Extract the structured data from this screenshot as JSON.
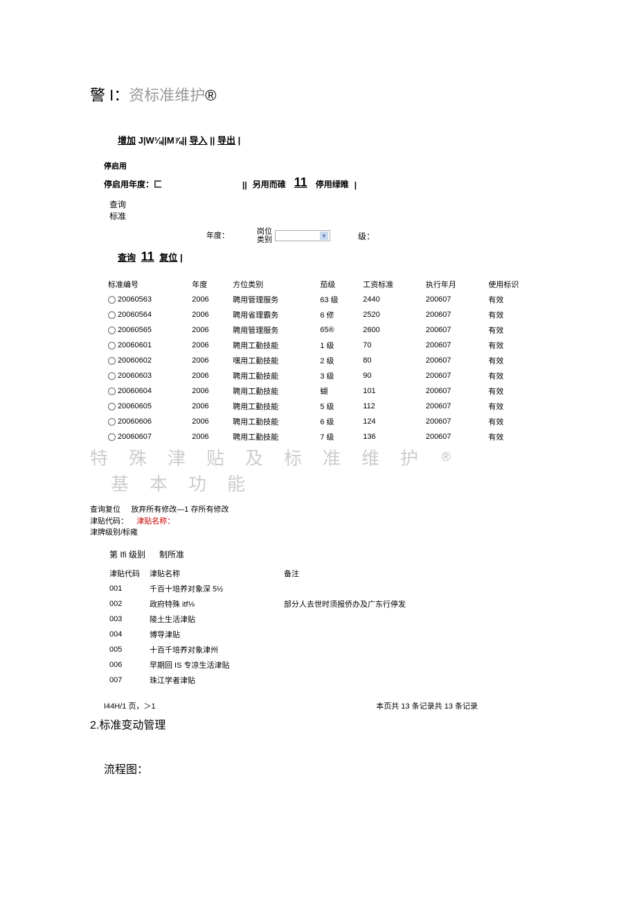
{
  "title1": {
    "prefix": "警 I：",
    "gray": "资标准维护",
    "suffix": "®"
  },
  "toolbar": {
    "add": "增加",
    "mid": "J|W⅛||M⅞||",
    "importL": "导入",
    "sep": "||",
    "exportL": "导出",
    "end": "|"
  },
  "stop": {
    "label": "停启用",
    "yearLabel": "停启用年度：匚",
    "mid_prefix": "||",
    "mid1": "另用而碓",
    "big": "11",
    "mid2": "停用绿睢",
    "mid_suffix": "|"
  },
  "query": {
    "label1": "查询",
    "label2": "标准",
    "yearLabel": "年度：",
    "catLabel1": "岗位",
    "catLabel2": "类别",
    "levelLabel": "级：",
    "sub_prefix": "查询",
    "sub_big": "11",
    "sub_link": "复位",
    "sub_suffix": "|"
  },
  "table1": {
    "headers": [
      "标准编号",
      "年度",
      "方位类别",
      "茄级",
      "工资标准",
      "执行年月",
      "使用标识"
    ],
    "rows": [
      {
        "id": "20060563",
        "year": "2006",
        "cat": "聘用管理服务",
        "lvl": "63 级",
        "std": "2440",
        "ym": "200607",
        "flag": "有效"
      },
      {
        "id": "20060564",
        "year": "2006",
        "cat": "聘用省理霸务",
        "lvl": "6 修",
        "std": "2520",
        "ym": "200607",
        "flag": "有效"
      },
      {
        "id": "20060565",
        "year": "2006",
        "cat": "聘用管理服务",
        "lvl": "65®",
        "std": "2600",
        "ym": "200607",
        "flag": "有效"
      },
      {
        "id": "20060601",
        "year": "2006",
        "cat": "聘用工勤技能",
        "lvl": "1 级",
        "std": "70",
        "ym": "200607",
        "flag": "有效"
      },
      {
        "id": "20060602",
        "year": "2006",
        "cat": "嘿用工勤技能",
        "lvl": "2 级",
        "std": "80",
        "ym": "200607",
        "flag": "有效"
      },
      {
        "id": "20060603",
        "year": "2006",
        "cat": "聘用工勤技能",
        "lvl": "3 级",
        "std": "90",
        "ym": "200607",
        "flag": "有效"
      },
      {
        "id": "20060604",
        "year": "2006",
        "cat": "聘用工勤技能",
        "lvl": "蝴",
        "std": "101",
        "ym": "200607",
        "flag": "有效"
      },
      {
        "id": "20060605",
        "year": "2006",
        "cat": "聘用工勤技能",
        "lvl": "5 级",
        "std": "112",
        "ym": "200607",
        "flag": "有效"
      },
      {
        "id": "20060606",
        "year": "2006",
        "cat": "聘用工勤技能",
        "lvl": "6 级",
        "std": "124",
        "ym": "200607",
        "flag": "有效"
      },
      {
        "id": "20060607",
        "year": "2006",
        "cat": "聘用工勤技能",
        "lvl": "7 级",
        "std": "136",
        "ym": "200607",
        "flag": "有效"
      }
    ]
  },
  "watermark": {
    "text": "特殊津贴及标准维护",
    "reg": "®",
    "tail": "基本功能"
  },
  "block2": {
    "line1a": "查询复位",
    "line1b": "放弃所有修改—1 存所有修改",
    "line2a": "津贴代码：",
    "line2b": "津贴名称：",
    "line3": "津牌级别/标雍",
    "header": {
      "a": "第 Ifi 级别",
      "b": "制所准"
    },
    "t_headers": [
      "津贴代码",
      "津贴名称",
      "备注"
    ],
    "rows": [
      {
        "code": "001",
        "name": "千百十培养对象深 5½",
        "note": ""
      },
      {
        "code": "002",
        "name": "政府特殊 itf⅛",
        "note": "部分人去世时须报侨办及广东行停发"
      },
      {
        "code": "003",
        "name": "陵土生活津贴",
        "note": ""
      },
      {
        "code": "004",
        "name": "博导津贴",
        "note": ""
      },
      {
        "code": "005",
        "name": "十百千培养对象津州",
        "note": ""
      },
      {
        "code": "006",
        "name": "早期回 IS 专凉生活津贴",
        "note": ""
      },
      {
        "code": "007",
        "name": "珠江学者津贴",
        "note": ""
      }
    ]
  },
  "footer": {
    "left": "I44H/1 页，＞1",
    "right": "本页共 13 条记录共 13 条记录"
  },
  "h2": "2.标准变动管理",
  "flow": "流程图："
}
